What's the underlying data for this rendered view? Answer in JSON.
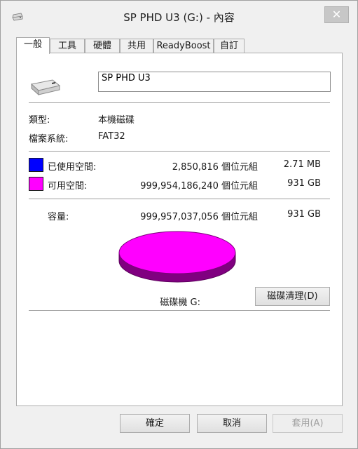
{
  "window": {
    "title": "SP PHD U3 (G:) - 內容",
    "close_label": "✕"
  },
  "tabs": [
    {
      "label": "一般",
      "active": true
    },
    {
      "label": "工具",
      "active": false
    },
    {
      "label": "硬體",
      "active": false
    },
    {
      "label": "共用",
      "active": false
    },
    {
      "label": "ReadyBoost",
      "active": false
    },
    {
      "label": "自訂",
      "active": false
    }
  ],
  "general": {
    "drive_name": "SP PHD U3",
    "type_label": "類型:",
    "type_value": "本機磁碟",
    "fs_label": "檔案系統:",
    "fs_value": "FAT32",
    "used": {
      "label": "已使用空間:",
      "bytes": "2,850,816 個位元組",
      "size": "2.71 MB",
      "color": "#0000ff"
    },
    "free": {
      "label": "可用空間:",
      "bytes": "999,954,186,240 個位元組",
      "size": "931 GB",
      "color": "#ff00ff"
    },
    "capacity": {
      "label": "容量:",
      "bytes": "999,957,037,056 個位元組",
      "size": "931 GB"
    },
    "drive_caption": "磁碟機 G:",
    "cleanup_button": "磁碟清理(D)"
  },
  "footer": {
    "ok": "確定",
    "cancel": "取消",
    "apply": "套用(A)"
  },
  "icons": {
    "title": "drive-icon",
    "drive": "hard-drive-icon"
  }
}
